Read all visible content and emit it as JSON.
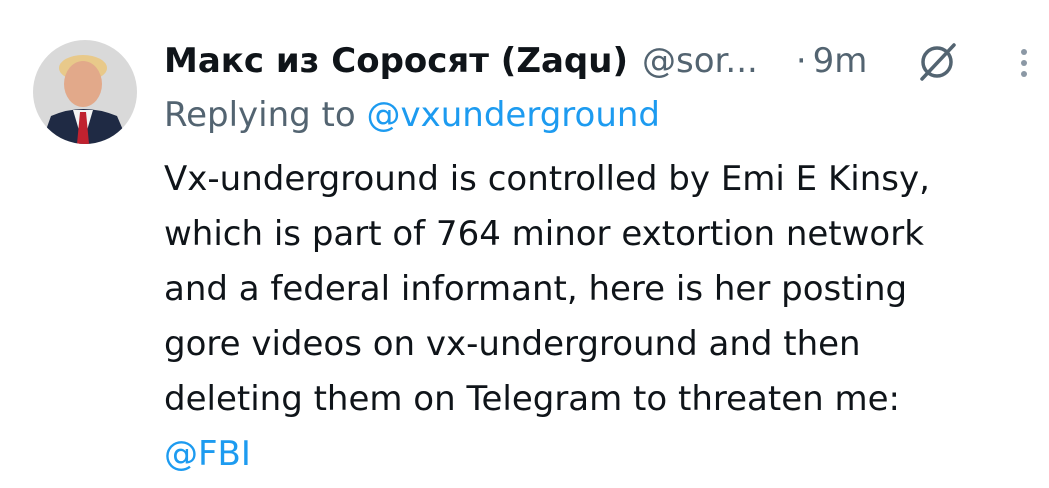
{
  "tweet": {
    "author": {
      "display_name": "Макс из Соросят (Zaqu)",
      "handle": "@sor...",
      "avatar": "avatar-photo"
    },
    "separator": "·",
    "time": "9m",
    "icons": {
      "grok": "grok-icon",
      "more": "more-icon"
    },
    "replying_prefix": "Replying to",
    "replying_to": "@vxunderground",
    "body_lines": [
      "Vx-underground is controlled by Emi E Kinsy,",
      "which is part of 764 minor extortion network",
      "and a federal informant, here is her posting",
      "gore videos on vx-underground and then",
      "deleting them on Telegram to threaten me:"
    ],
    "mention_line": "@FBI"
  },
  "colors": {
    "text": "#0f1419",
    "secondary": "#536471",
    "link": "#1d9bf0",
    "background": "#ffffff"
  }
}
